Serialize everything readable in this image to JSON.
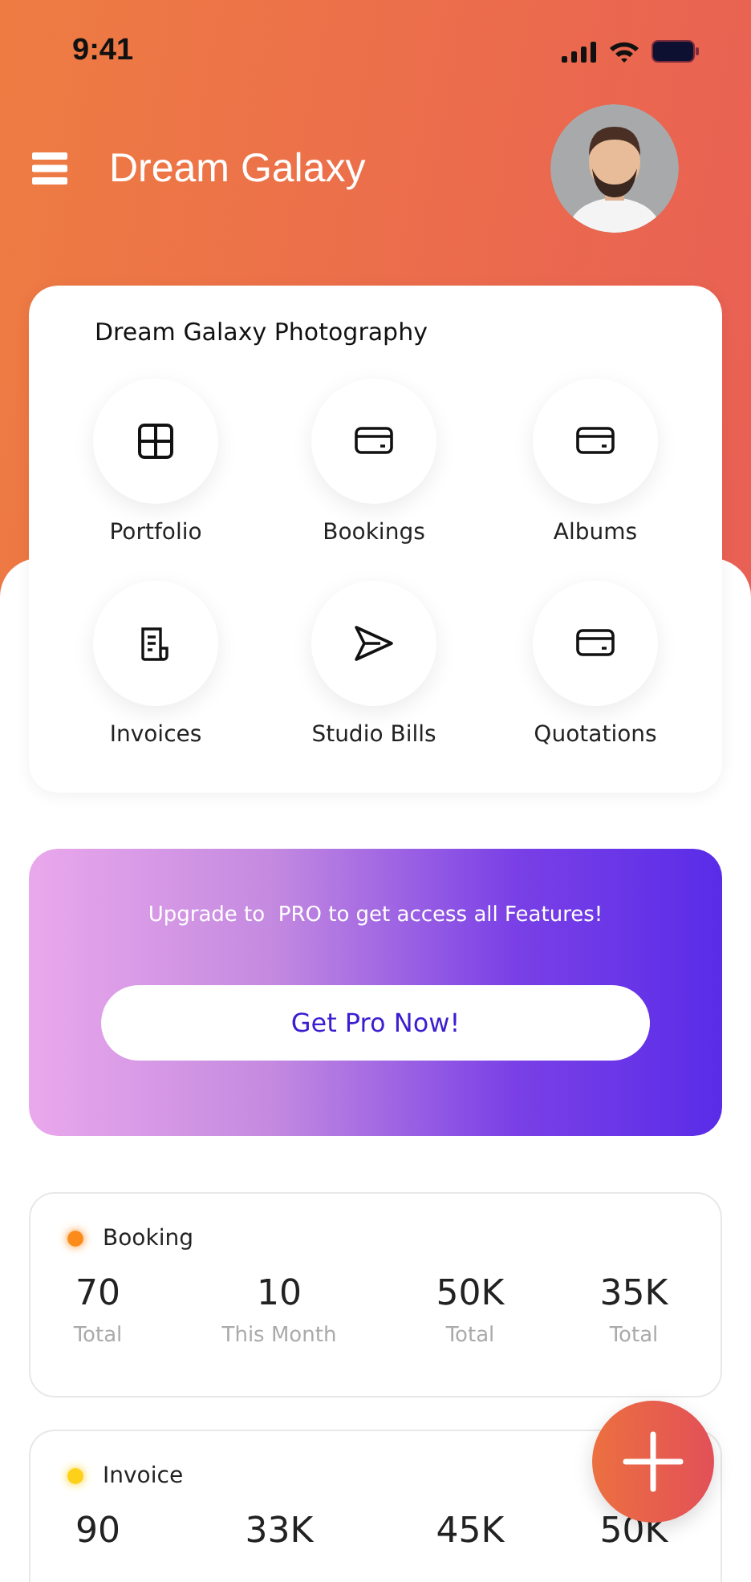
{
  "status_bar": {
    "time": "9:41"
  },
  "header": {
    "title": "Dream Galaxy"
  },
  "shortcuts": {
    "title": "Dream Galaxy Photography",
    "items": [
      {
        "label": "Portfolio",
        "kind": "grid"
      },
      {
        "label": "Bookings",
        "kind": "card"
      },
      {
        "label": "Albums",
        "kind": "card"
      },
      {
        "label": "Invoices",
        "kind": "document"
      },
      {
        "label": "Studio Bills",
        "kind": "send"
      },
      {
        "label": "Quotations",
        "kind": "card"
      }
    ]
  },
  "promo": {
    "text": "Upgrade to  PRO to get access all Features!",
    "button": "Get Pro Now!"
  },
  "stats": [
    {
      "title": "Booking",
      "color": "#fb8c1c",
      "metrics": [
        {
          "value": "70",
          "label": "Total"
        },
        {
          "value": "10",
          "label": "This Month"
        },
        {
          "value": "50K",
          "label": "Total"
        },
        {
          "value": "35K",
          "label": "Total"
        }
      ]
    },
    {
      "title": "Invoice",
      "color": "#fdd11a",
      "metrics": [
        {
          "value": "90"
        },
        {
          "value": "33K"
        },
        {
          "value": "45K"
        },
        {
          "value": "50K"
        }
      ]
    }
  ],
  "fab": {
    "kind": "plus"
  }
}
